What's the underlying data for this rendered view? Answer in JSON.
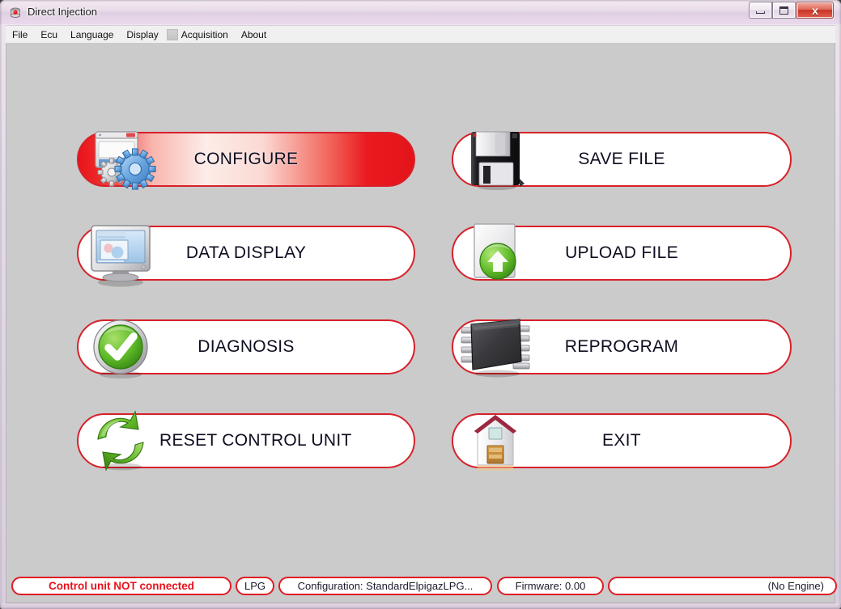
{
  "window": {
    "title": "Direct Injection",
    "icon": "app-icon",
    "controls": {
      "minimize": "minimize-button",
      "maximize": "maximize-button",
      "close_label": "x"
    }
  },
  "menubar": {
    "items": [
      {
        "label": "File",
        "name": "menu-file"
      },
      {
        "label": "Ecu",
        "name": "menu-ecu"
      },
      {
        "label": "Language",
        "name": "menu-language"
      },
      {
        "label": "Display",
        "name": "menu-display"
      },
      {
        "label": "Acquisition",
        "name": "menu-acquisition",
        "has_indicator": true
      },
      {
        "label": "About",
        "name": "menu-about"
      }
    ]
  },
  "main": {
    "buttons": [
      {
        "label": "CONFIGURE",
        "icon": "window-gears-icon",
        "state": "active"
      },
      {
        "label": "DATA DISPLAY",
        "icon": "monitor-icon",
        "state": "normal"
      },
      {
        "label": "DIAGNOSIS",
        "icon": "green-check-icon",
        "state": "normal"
      },
      {
        "label": "RESET CONTROL UNIT",
        "icon": "green-refresh-icon",
        "state": "normal"
      },
      {
        "label": "SAVE FILE",
        "icon": "floppy-disk-icon",
        "state": "normal"
      },
      {
        "label": "UPLOAD FILE",
        "icon": "upload-arrow-icon",
        "state": "normal"
      },
      {
        "label": "REPROGRAM",
        "icon": "chip-icon",
        "state": "normal"
      },
      {
        "label": "EXIT",
        "icon": "house-icon",
        "state": "normal"
      }
    ]
  },
  "statusbar": {
    "connection": "Control unit NOT connected",
    "fuel": "LPG",
    "configuration": "Configuration: StandardElpigazLPG...",
    "firmware": "Firmware: 0.00",
    "engine": "(No Engine)"
  },
  "colors": {
    "accent_red": "#e01b24",
    "error_red": "#e8121b",
    "client_bg": "#cbcbcb",
    "titlebar": "#e8dcea"
  }
}
